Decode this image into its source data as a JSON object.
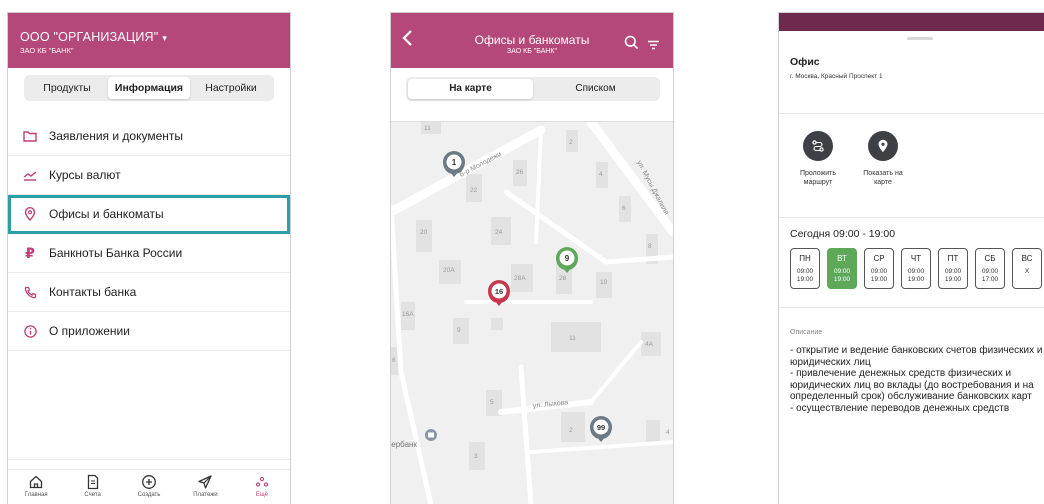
{
  "screen1": {
    "org_name": "ООО \"ОРГАНИЗАЦИЯ\"",
    "bank_name": "ЗАО КБ \"БАНК\"",
    "tabs": [
      {
        "label": "Продукты",
        "active": false
      },
      {
        "label": "Информация",
        "active": true
      },
      {
        "label": "Настройки",
        "active": false
      }
    ],
    "menu": [
      {
        "label": "Заявления и документы",
        "icon": "folder-icon"
      },
      {
        "label": "Курсы валют",
        "icon": "chart-line-icon"
      },
      {
        "label": "Офисы и банкоматы",
        "icon": "location-pin-icon",
        "selected": true
      },
      {
        "label": "Банкноты Банка России",
        "icon": "ruble-icon"
      },
      {
        "label": "Контакты банка",
        "icon": "phone-icon"
      },
      {
        "label": "О приложении",
        "icon": "info-icon"
      }
    ],
    "bottom_nav": [
      {
        "label": "Главная",
        "icon": "home-icon"
      },
      {
        "label": "Счета",
        "icon": "document-icon"
      },
      {
        "label": "Создать",
        "icon": "plus-circle-icon"
      },
      {
        "label": "Платежи",
        "icon": "send-icon"
      },
      {
        "label": "Ещё",
        "icon": "more-icon",
        "active": true
      }
    ]
  },
  "screen2": {
    "title": "Офисы и банкоматы",
    "subtitle": "ЗАО КБ \"БАНК\"",
    "tabs": [
      {
        "label": "На карте",
        "active": true
      },
      {
        "label": "Списком",
        "active": false
      }
    ],
    "map": {
      "streets": [
        "б-р Молодежи",
        "ул. Мусы Джалиля",
        "ул. Лыкова"
      ],
      "building_numbers": [
        "11",
        "2",
        "26",
        "4",
        "22",
        "6",
        "20",
        "24",
        "8",
        "20А",
        "28А",
        "28",
        "10",
        "16А",
        "9",
        "11",
        "4А",
        "6",
        "5",
        "2",
        "4",
        "3"
      ],
      "poi_label": "Сбербанк",
      "markers": [
        {
          "count": "1",
          "color": "#6c7a86"
        },
        {
          "count": "9",
          "color": "#5ea85a"
        },
        {
          "count": "16",
          "color": "#c8374e"
        },
        {
          "count": "99",
          "color": "#6c7a86"
        }
      ]
    }
  },
  "screen3": {
    "title": "Офис",
    "address": "г. Москва, Красный Проспект 1",
    "actions": [
      {
        "label": "Проложить маршрут",
        "icon": "route-icon"
      },
      {
        "label": "Показать на карте",
        "icon": "location-pin-icon"
      }
    ],
    "today": "Сегодня 09:00 - 19:00",
    "days": [
      {
        "name": "ПН",
        "hours": "09:00\n19:00",
        "active": false
      },
      {
        "name": "ВТ",
        "hours": "09:00\n19:00",
        "active": true
      },
      {
        "name": "СР",
        "hours": "09:00\n19:00",
        "active": false
      },
      {
        "name": "ЧТ",
        "hours": "09:00\n19:00",
        "active": false
      },
      {
        "name": "ПТ",
        "hours": "09:00\n19:00",
        "active": false
      },
      {
        "name": "СБ",
        "hours": "09:00\n17:00",
        "active": false
      },
      {
        "name": "ВС",
        "hours": "Х",
        "active": false
      }
    ],
    "description_label": "Описание",
    "description": "- открытие и ведение банковских счетов физических и юридических лиц\n- привлечение денежных средств физических и юридических лиц во вклады (до востребования и на определенный срок) обслуживание банковских карт\n- осуществление переводов денежных средств"
  },
  "colors": {
    "brand": "#b5487a",
    "accent_teal": "#2a9fa8",
    "green": "#5ea85a",
    "red_marker": "#c8374e",
    "gray_marker": "#6c7a86"
  }
}
